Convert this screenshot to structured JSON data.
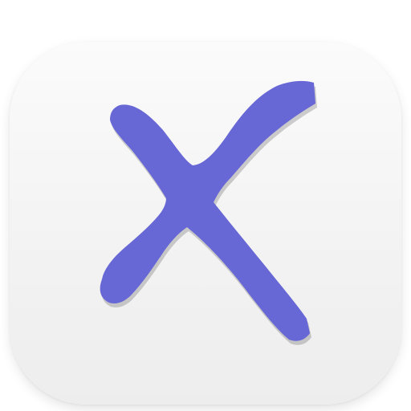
{
  "icon": {
    "name": "x-mark-icon",
    "glyph_color": "#6767d6",
    "tile_color": "#f5f5f5"
  }
}
